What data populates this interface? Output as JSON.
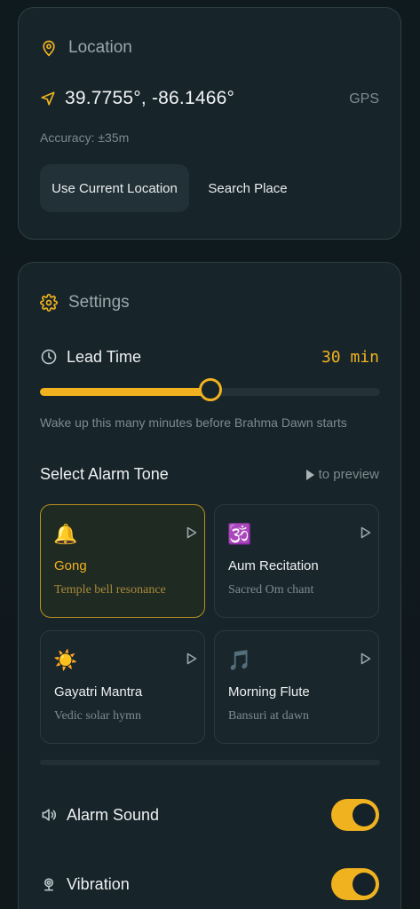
{
  "location": {
    "title": "Location",
    "coords": "39.7755°, -86.1466°",
    "source": "GPS",
    "accuracy": "Accuracy: ±35m",
    "use_current_label": "Use Current Location",
    "search_place_label": "Search Place"
  },
  "settings": {
    "title": "Settings",
    "lead_time": {
      "label": "Lead Time",
      "value_text": "30 min",
      "value": 30,
      "fill_fraction": 0.5,
      "description": "Wake up this many minutes before Brahma Dawn starts"
    },
    "alarm_tone": {
      "title": "Select Alarm Tone",
      "hint": "to preview",
      "tones": [
        {
          "emoji": "🔔",
          "name": "Gong",
          "description": "Temple bell resonance",
          "selected": true
        },
        {
          "emoji": "🕉️",
          "name": "Aum Recitation",
          "description": "Sacred Om chant",
          "selected": false
        },
        {
          "emoji": "☀️",
          "name": "Gayatri Mantra",
          "description": "Vedic solar hymn",
          "selected": false
        },
        {
          "emoji": "🎵",
          "name": "Morning Flute",
          "description": "Bansuri at dawn",
          "selected": false
        }
      ]
    },
    "alarm_sound": {
      "label": "Alarm Sound",
      "on": true
    },
    "vibration": {
      "label": "Vibration",
      "on": true
    }
  },
  "colors": {
    "accent": "#f1b21f",
    "card": "#17252b",
    "muted": "#7d8a8e"
  }
}
